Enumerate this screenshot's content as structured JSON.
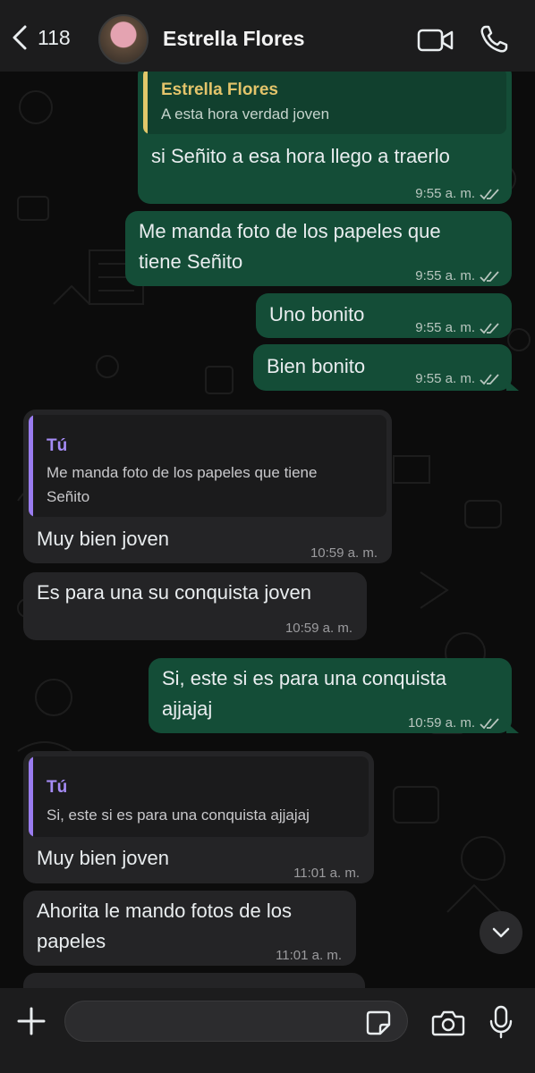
{
  "header": {
    "back_count": "118",
    "contact_name": "Estrella Flores"
  },
  "messages": [
    {
      "direction": "out",
      "quote": {
        "author": "Estrella Flores",
        "text": "A esta hora verdad joven"
      },
      "text": "si Señito a esa hora llego a traerlo",
      "time": "9:55 a. m."
    },
    {
      "direction": "out",
      "text": "Me manda foto de los papeles que tiene Señito",
      "lines": [
        "Me manda foto de los papeles que",
        "tiene Señito"
      ],
      "time": "9:55 a. m."
    },
    {
      "direction": "out",
      "text": "Uno bonito",
      "time": "9:55 a. m."
    },
    {
      "direction": "out",
      "text": "Bien bonito",
      "time": "9:55 a. m."
    },
    {
      "direction": "in",
      "quote": {
        "author": "Tú",
        "lines": [
          "Me manda foto de los papeles que tiene",
          "Señito"
        ]
      },
      "text": "Muy bien joven",
      "time": "10:59 a. m."
    },
    {
      "direction": "in",
      "text": "Es para una su conquista joven",
      "time": "10:59 a. m."
    },
    {
      "direction": "out",
      "lines": [
        "Si, este si es para una conquista",
        "ajjajaj"
      ],
      "time": "10:59 a. m."
    },
    {
      "direction": "in",
      "quote": {
        "author": "Tú",
        "text": "Si, este si es para una conquista ajjajaj"
      },
      "text": "Muy bien joven",
      "time": "11:01 a. m."
    },
    {
      "direction": "in",
      "lines": [
        "Ahorita le mando fotos de los",
        "papeles"
      ],
      "time": "11:01 a. m."
    }
  ],
  "composer": {
    "placeholder": ""
  },
  "icons": {
    "back": "chevron-left-icon",
    "video": "video-camera-icon",
    "call": "phone-icon",
    "plus": "plus-icon",
    "sticker": "sticker-icon",
    "camera": "camera-icon",
    "mic": "microphone-icon",
    "scroll": "chevron-down-icon",
    "read": "double-check-icon"
  },
  "colors": {
    "outgoing_bubble": "#144d37",
    "incoming_bubble": "#242426",
    "quote_author_contact": "#e3c46b",
    "quote_author_self": "#a58bf5",
    "background": "#0c0c0c",
    "bar": "#1c1c1d"
  }
}
